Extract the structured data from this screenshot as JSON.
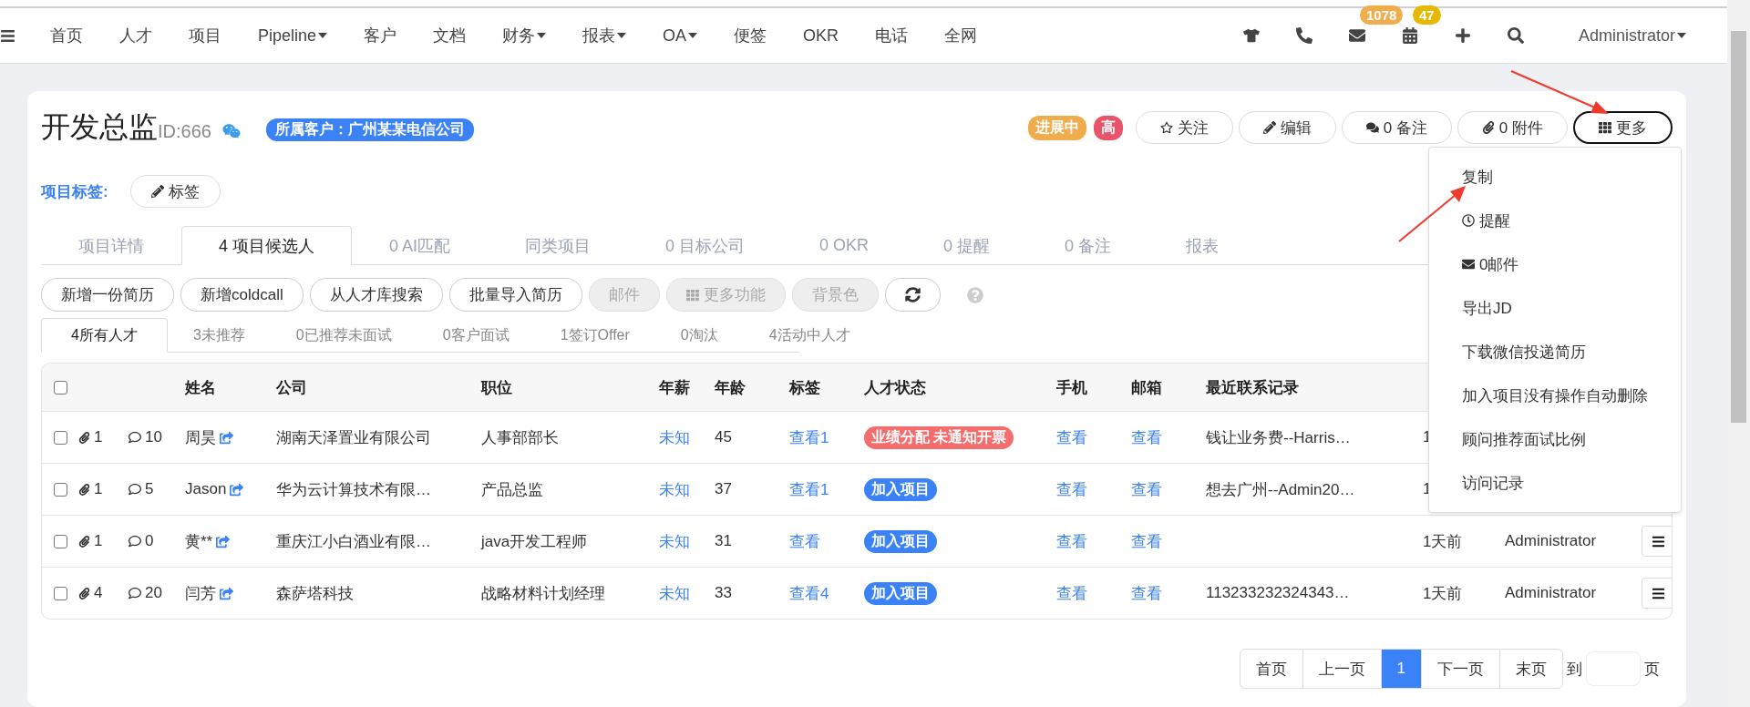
{
  "nav": {
    "items": [
      {
        "label": "首页",
        "dropdown": false
      },
      {
        "label": "人才",
        "dropdown": false
      },
      {
        "label": "项目",
        "dropdown": false
      },
      {
        "label": "Pipeline",
        "dropdown": true
      },
      {
        "label": "客户",
        "dropdown": false
      },
      {
        "label": "文档",
        "dropdown": false
      },
      {
        "label": "财务",
        "dropdown": true
      },
      {
        "label": "报表",
        "dropdown": true
      },
      {
        "label": "OA",
        "dropdown": true
      },
      {
        "label": "便签",
        "dropdown": false
      },
      {
        "label": "OKR",
        "dropdown": false
      },
      {
        "label": "电话",
        "dropdown": false
      },
      {
        "label": "全网",
        "dropdown": false
      }
    ],
    "tools": [
      {
        "kind": "shirt"
      },
      {
        "kind": "phone"
      },
      {
        "kind": "mail",
        "badge": "1078",
        "color": "#f0ad4e"
      },
      {
        "kind": "calendar",
        "badge": "47",
        "color": "#e6b800"
      },
      {
        "kind": "plus"
      },
      {
        "kind": "search"
      }
    ],
    "user": "Administrator"
  },
  "header": {
    "title": "开发总监",
    "id": "ID:666",
    "client": "所属客户：广州某某电信公司",
    "badges": [
      {
        "label": "进展中",
        "color": "#f0ad4e"
      },
      {
        "label": "高",
        "color": "#e9546b"
      }
    ],
    "actions": [
      {
        "label": "关注",
        "kind": "star",
        "expanded": false
      },
      {
        "label": "编辑",
        "kind": "pencil",
        "expanded": false
      },
      {
        "label": "0 备注",
        "kind": "comments",
        "expanded": false
      },
      {
        "label": "0 附件",
        "kind": "paperclip",
        "expanded": false
      },
      {
        "label": "更多",
        "kind": "grid",
        "expanded": true
      }
    ]
  },
  "tags": {
    "label": "项目标签:",
    "button": "标签"
  },
  "tabs": [
    {
      "label": "项目详情",
      "selected": false
    },
    {
      "label": "4 项目候选人",
      "selected": true
    },
    {
      "label": "0 AI匹配",
      "selected": false
    },
    {
      "label": "同类项目",
      "selected": false
    },
    {
      "label": "0 目标公司",
      "selected": false
    },
    {
      "label": "0 OKR",
      "selected": false
    },
    {
      "label": "0 提醒",
      "selected": false
    },
    {
      "label": "0 备注",
      "selected": false
    },
    {
      "label": "报表",
      "selected": false
    }
  ],
  "toolbar": [
    {
      "label": "新增一份简历",
      "disabled": false,
      "kind": "text"
    },
    {
      "label": "新增coldcall",
      "disabled": false,
      "kind": "text"
    },
    {
      "label": "从人才库搜索",
      "disabled": false,
      "kind": "text"
    },
    {
      "label": "批量导入简历",
      "disabled": false,
      "kind": "text"
    },
    {
      "label": "邮件",
      "disabled": true,
      "kind": "text"
    },
    {
      "label": "更多功能",
      "disabled": true,
      "kind": "grid"
    },
    {
      "label": "背景色",
      "disabled": true,
      "kind": "text"
    },
    {
      "disabled": false,
      "kind": "refresh"
    }
  ],
  "subtabs": [
    {
      "label": "4所有人才",
      "selected": true
    },
    {
      "label": "3未推荐",
      "selected": false
    },
    {
      "label": "0已推荐未面试",
      "selected": false
    },
    {
      "label": "0客户面试",
      "selected": false
    },
    {
      "label": "1签订Offer",
      "selected": false
    },
    {
      "label": "0淘汰",
      "selected": false
    },
    {
      "label": "4活动中人才",
      "selected": false
    }
  ],
  "table": {
    "select_all": {
      "checked": false
    },
    "columns": [
      "姓名",
      "公司",
      "职位",
      "年薪",
      "年龄",
      "标签",
      "人才状态",
      "手机",
      "邮箱",
      "最近联系记录"
    ],
    "rows": [
      {
        "checked": false,
        "attachments": "1",
        "comments": "10",
        "name": "周昊",
        "company": "湖南天泽置业有限公司",
        "position": "人事部部长",
        "salary": "未知",
        "age": "45",
        "tag": "查看1",
        "status": {
          "label": "业绩分配 未通知开票",
          "color": "#f56c6c"
        },
        "phone": "查看",
        "email": "查看",
        "recent": "钱让业务费--Harris…",
        "time": "1"
      },
      {
        "checked": false,
        "attachments": "1",
        "comments": "5",
        "name": "Jason",
        "company": "华为云计算技术有限…",
        "position": "产品总监",
        "salary": "未知",
        "age": "37",
        "tag": "查看1",
        "status": {
          "label": "加入项目",
          "color": "#3b82f6"
        },
        "phone": "查看",
        "email": "查看",
        "recent": "想去广州--Admin20…",
        "time": "1"
      },
      {
        "checked": false,
        "attachments": "1",
        "comments": "0",
        "name": "黄**",
        "company": "重庆江小白酒业有限…",
        "position": "java开发工程师",
        "salary": "未知",
        "age": "31",
        "tag": "查看",
        "status": {
          "label": "加入项目",
          "color": "#3b82f6"
        },
        "phone": "查看",
        "email": "查看",
        "time": "1天前",
        "owner": "Administrator"
      },
      {
        "checked": false,
        "attachments": "4",
        "comments": "20",
        "name": "闫芳",
        "company": "森萨塔科技",
        "position": "战略材料计划经理",
        "salary": "未知",
        "age": "33",
        "tag": "查看4",
        "status": {
          "label": "加入项目",
          "color": "#3b82f6"
        },
        "phone": "查看",
        "email": "查看",
        "recent": "113233232324343…",
        "time": "1天前",
        "owner": "Administrator"
      }
    ]
  },
  "pagination": {
    "pages": [
      {
        "label": "首页",
        "selected": false
      },
      {
        "label": "上一页",
        "selected": false
      },
      {
        "label": "1",
        "selected": true
      },
      {
        "label": "下一页",
        "selected": false
      },
      {
        "label": "末页",
        "selected": false
      }
    ],
    "goto": "到",
    "suffix": "页"
  },
  "menu": {
    "items": [
      {
        "label": "复制",
        "kind": "text"
      },
      {
        "label": "提醒",
        "kind": "clock"
      },
      {
        "label": "0邮件",
        "kind": "envelope"
      },
      {
        "label": "导出JD",
        "kind": "text"
      },
      {
        "label": "下载微信投递简历",
        "kind": "text"
      },
      {
        "label": "加入项目没有操作自动删除",
        "kind": "text"
      },
      {
        "label": "顾问推荐面试比例",
        "kind": "text"
      },
      {
        "label": "访问记录",
        "kind": "text"
      }
    ]
  }
}
